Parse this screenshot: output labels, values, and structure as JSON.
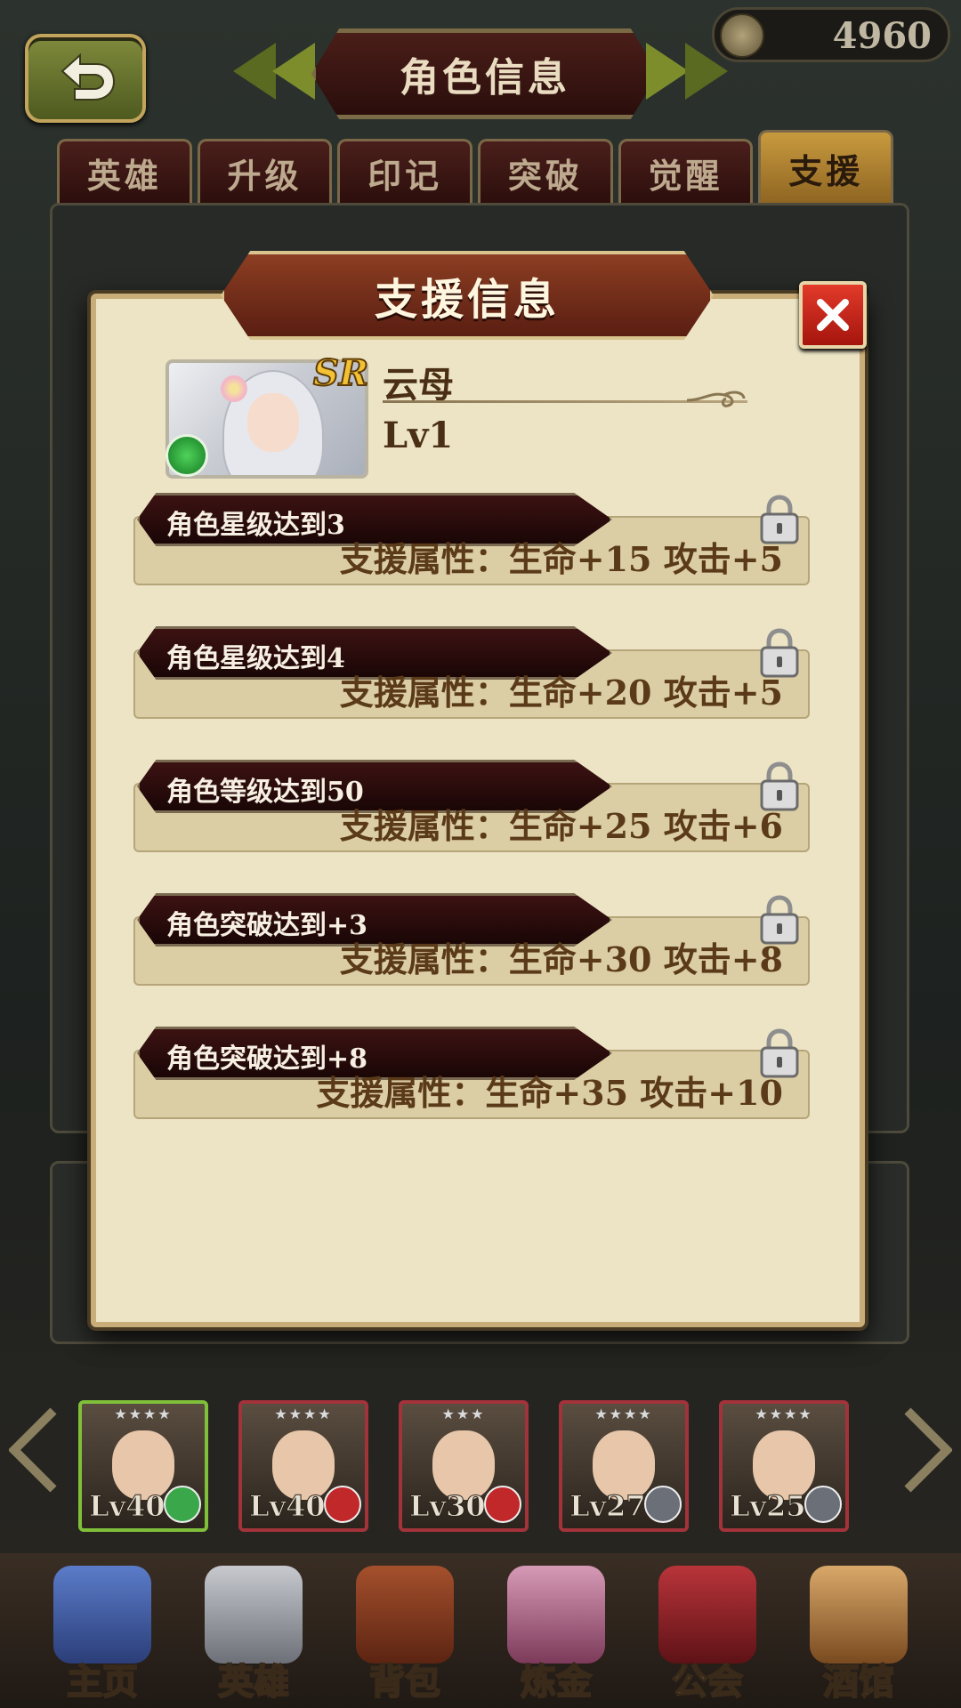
{
  "header": {
    "title": "角色信息",
    "currency_value": "4960"
  },
  "tabs": [
    {
      "label": "英雄"
    },
    {
      "label": "升级"
    },
    {
      "label": "印记"
    },
    {
      "label": "突破"
    },
    {
      "label": "觉醒"
    },
    {
      "label": "支援"
    }
  ],
  "active_tab": "支援",
  "dialog": {
    "title": "支援信息",
    "character": {
      "rarity": "SR",
      "name": "云母",
      "level": "Lv1"
    },
    "rows": [
      {
        "condition": "角色星级达到3",
        "attr": "支援属性：生命+15 攻击+5",
        "locked": true
      },
      {
        "condition": "角色星级达到4",
        "attr": "支援属性：生命+20 攻击+5",
        "locked": true
      },
      {
        "condition": "角色等级达到50",
        "attr": "支援属性：生命+25 攻击+6",
        "locked": true
      },
      {
        "condition": "角色突破达到+3",
        "attr": "支援属性：生命+30 攻击+8",
        "locked": true
      },
      {
        "condition": "角色突破达到+8",
        "attr": "支援属性：生命+35 攻击+10",
        "locked": true
      }
    ]
  },
  "roster": [
    {
      "level": "Lv40",
      "stars": "★★★★",
      "class_color": "#3aa84a",
      "selected": true
    },
    {
      "level": "Lv40",
      "stars": "★★★★",
      "class_color": "#c0282a",
      "selected": false
    },
    {
      "level": "Lv30",
      "stars": "★★★",
      "class_color": "#c0282a",
      "selected": false
    },
    {
      "level": "Lv27",
      "stars": "★★★★",
      "class_color": "#6b6f78",
      "selected": false
    },
    {
      "level": "Lv25",
      "stars": "★★★★",
      "class_color": "#6b6f78",
      "selected": false
    }
  ],
  "nav": [
    {
      "label": "主页",
      "icon": "castle-icon"
    },
    {
      "label": "英雄",
      "icon": "knight-helmet-icon"
    },
    {
      "label": "背包",
      "icon": "backpack-icon"
    },
    {
      "label": "炼金",
      "icon": "alchemy-flask-icon"
    },
    {
      "label": "公会",
      "icon": "guild-shield-icon"
    },
    {
      "label": "酒馆",
      "icon": "tavern-mug-icon"
    }
  ],
  "colors": {
    "dialog_bg": "#ece4c5",
    "active_tab": "#c89a3e",
    "close_button": "#d42a1e",
    "row_text": "#5a3a18"
  }
}
